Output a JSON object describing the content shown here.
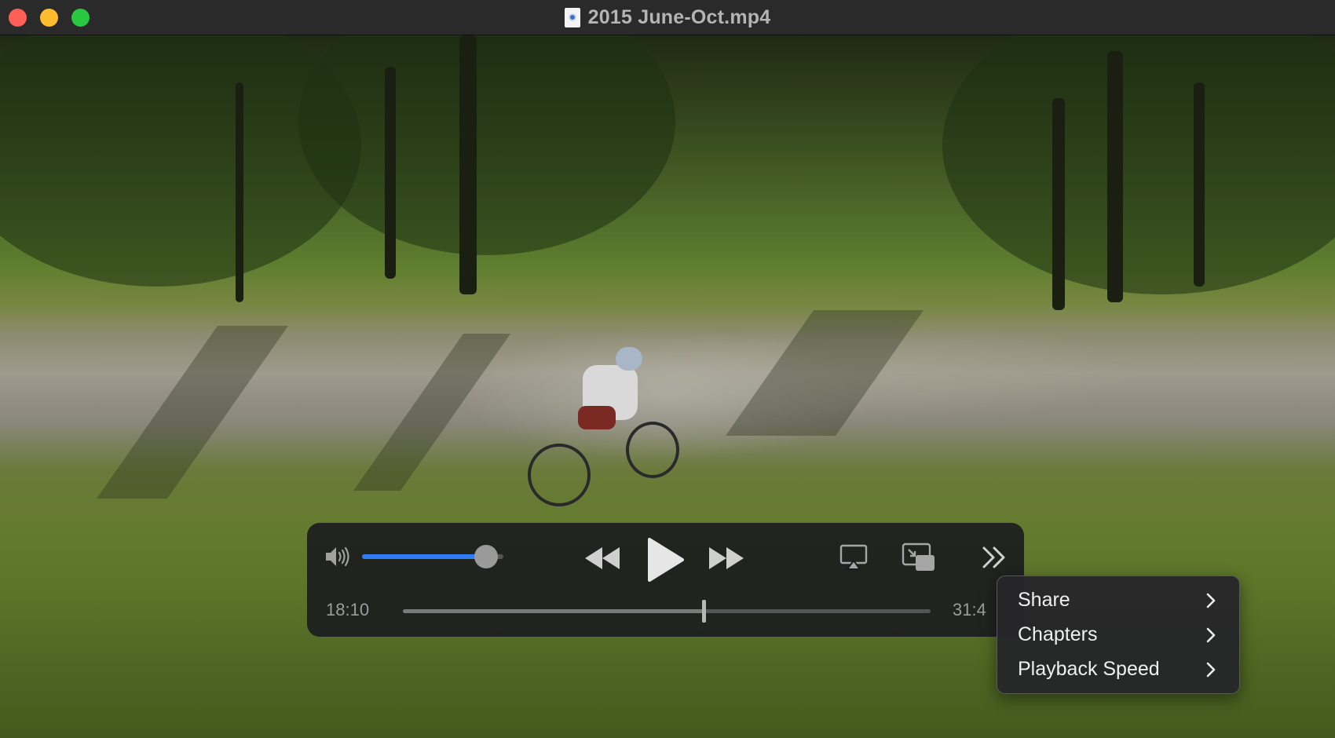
{
  "window": {
    "title": "2015 June-Oct.mp4",
    "file_icon": "quicktime-document-icon"
  },
  "player": {
    "volume": 0.88,
    "elapsed": "18:10",
    "total": "31:4",
    "progress": 0.57,
    "icons": {
      "volume": "speaker-icon",
      "rewind": "rewind-icon",
      "play": "play-icon",
      "fast_forward": "fast-forward-icon",
      "airplay": "airplay-icon",
      "pip": "picture-in-picture-icon",
      "more": "more-chevrons-icon"
    },
    "accent_color": "#2f7cf6"
  },
  "menu": {
    "items": [
      {
        "label": "Share"
      },
      {
        "label": "Chapters"
      },
      {
        "label": "Playback Speed"
      }
    ]
  }
}
